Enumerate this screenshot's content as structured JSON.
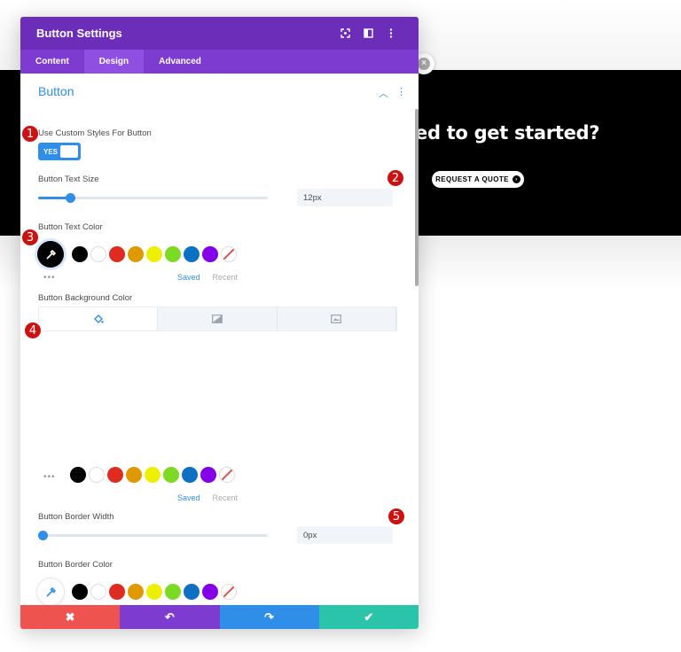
{
  "background_page": {
    "headline": "ed to get started?",
    "cta_label": "REQUEST A QUOTE",
    "cta_arrow": "›"
  },
  "modal": {
    "title": "Button Settings",
    "header_icons": [
      "expand-icon",
      "columns-icon",
      "more-icon"
    ],
    "tabs": [
      {
        "label": "Content",
        "active": false
      },
      {
        "label": "Design",
        "active": true
      },
      {
        "label": "Advanced",
        "active": false
      }
    ],
    "section": {
      "title": "Button",
      "custom_styles_label": "Use Custom Styles For Button",
      "toggle_value": "YES",
      "text_size_label": "Button Text Size",
      "text_size_value": "12px",
      "text_size_fraction": 0.12,
      "text_color_label": "Button Text Color",
      "bg_color_label": "Button Background Color",
      "border_width_label": "Button Border Width",
      "border_width_value": "0px",
      "border_width_fraction": 0.0,
      "border_color_label": "Button Border Color"
    },
    "palette": [
      "#000000",
      "#ffffff",
      "#e02b20",
      "#e09900",
      "#edf000",
      "#7cda24",
      "#0c71c3",
      "#8300e9"
    ],
    "saved_label": "Saved",
    "recent_label": "Recent",
    "more_dots": "•••",
    "footer": [
      "✖",
      "↶",
      "↷",
      "✔"
    ],
    "footer_colors": [
      "#ef5350",
      "#7d3bcf",
      "#2e8ee8",
      "#29c4a9"
    ]
  },
  "markers": [
    "1",
    "2",
    "3",
    "4",
    "5"
  ],
  "colors": {
    "header_purple": "#6c2eb9",
    "tab_purple": "#7d3bcf",
    "accent_blue": "#2e8ee8",
    "marker_red": "#cc1111"
  }
}
